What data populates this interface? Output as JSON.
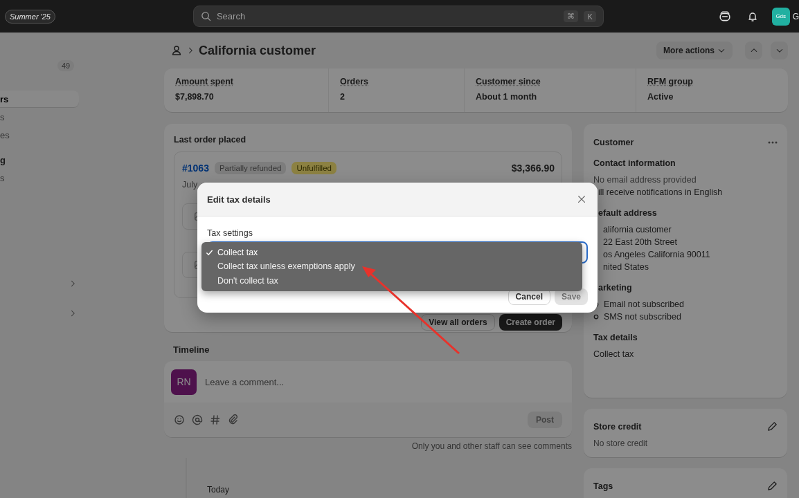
{
  "topbar": {
    "badge": "Summer '25",
    "search": {
      "placeholder": "Search",
      "keys": [
        "⌘",
        "K"
      ]
    },
    "avatar": "Gds",
    "store_name": "G"
  },
  "sidebar": {
    "badge": "49",
    "items": [
      {
        "label": "rs",
        "selected": true
      },
      {
        "label": "s",
        "selected": false
      },
      {
        "label": "es",
        "selected": false
      },
      {
        "label": "g",
        "selected": false,
        "kind": "heading"
      },
      {
        "label": "s",
        "selected": false
      }
    ]
  },
  "header": {
    "title": "California customer",
    "more_actions": "More actions"
  },
  "stats": [
    {
      "label": "Amount spent",
      "value": "$7,898.70"
    },
    {
      "label": "Orders",
      "value": "2"
    },
    {
      "label": "Customer since",
      "value": "About 1 month"
    },
    {
      "label": "RFM group",
      "value": "Active"
    }
  ],
  "last_order": {
    "title": "Last order placed",
    "number": "#1063",
    "badges": [
      {
        "label": "Partially refunded",
        "kind": "neutral"
      },
      {
        "label": "Unfulfilled",
        "kind": "warning"
      }
    ],
    "total": "$3,366.90",
    "date": "July",
    "buttons": [
      "View all orders",
      "Create order"
    ]
  },
  "timeline": {
    "title": "Timeline",
    "avatar": "RN",
    "placeholder": "Leave a comment...",
    "post": "Post",
    "note": "Only you and other staff can see comments",
    "day": "Today"
  },
  "customer": {
    "title": "Customer",
    "sections": [
      {
        "title": "Contact information",
        "lines": [
          "No email address provided",
          "ill receive notifications in English"
        ]
      },
      {
        "title": "efault address",
        "clipped": true,
        "lines": [
          "alifornia customer",
          "22 East 20th Street",
          "os Angeles California 90011",
          "nited States"
        ]
      },
      {
        "title": "arketing",
        "clipped": true,
        "subscriptions": [
          "Email not subscribed",
          "SMS not subscribed"
        ]
      },
      {
        "title": "Tax details",
        "lines": [
          "Collect tax"
        ]
      }
    ]
  },
  "store_credit": {
    "title": "Store credit",
    "value": "No store credit"
  },
  "tags": {
    "title": "Tags"
  },
  "modal": {
    "title": "Edit tax details",
    "label": "Tax settings",
    "options": [
      {
        "label": "Collect tax",
        "selected": true
      },
      {
        "label": "Collect tax unless exemptions apply",
        "selected": false
      },
      {
        "label": "Don't collect tax",
        "selected": false
      }
    ],
    "buttons": [
      {
        "label": "Cancel",
        "disabled": false
      },
      {
        "label": "Save",
        "disabled": true
      }
    ]
  }
}
